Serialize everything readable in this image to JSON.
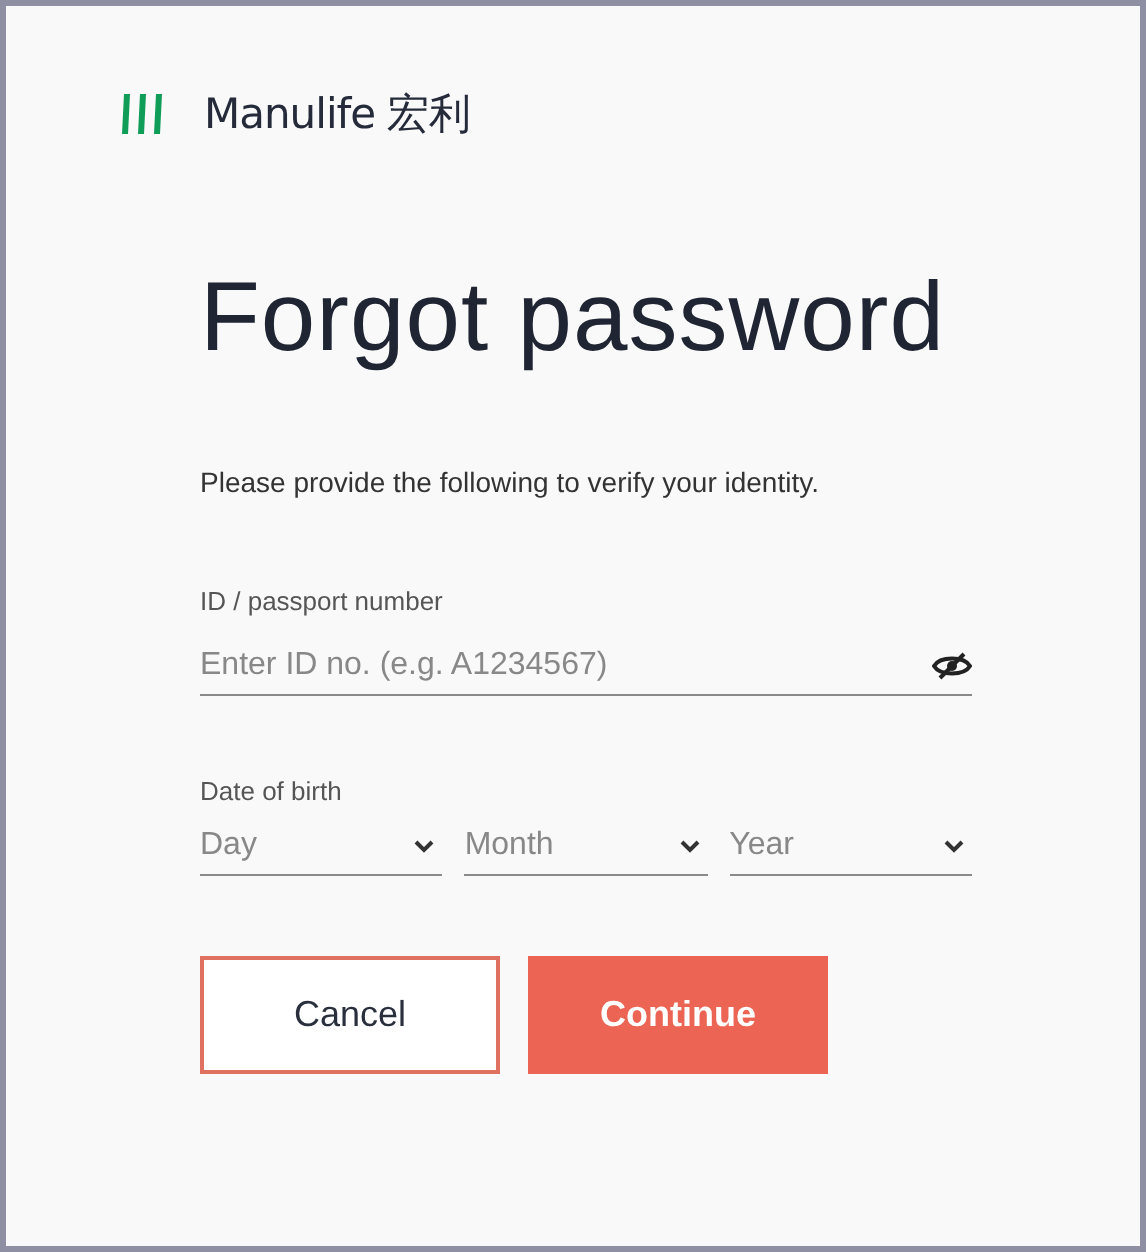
{
  "logo": {
    "name": "Manulife",
    "name_zh": "宏利"
  },
  "title": "Forgot password",
  "intro": "Please provide the following to verify your identity.",
  "id_field": {
    "label": "ID / passport number",
    "placeholder": "Enter ID no. (e.g. A1234567)",
    "masked": true
  },
  "dob": {
    "label": "Date of birth",
    "selects": [
      {
        "placeholder": "Day"
      },
      {
        "placeholder": "Month"
      },
      {
        "placeholder": "Year"
      }
    ]
  },
  "buttons": [
    {
      "label": "Cancel",
      "kind": "secondary"
    },
    {
      "label": "Continue",
      "kind": "primary"
    }
  ]
}
